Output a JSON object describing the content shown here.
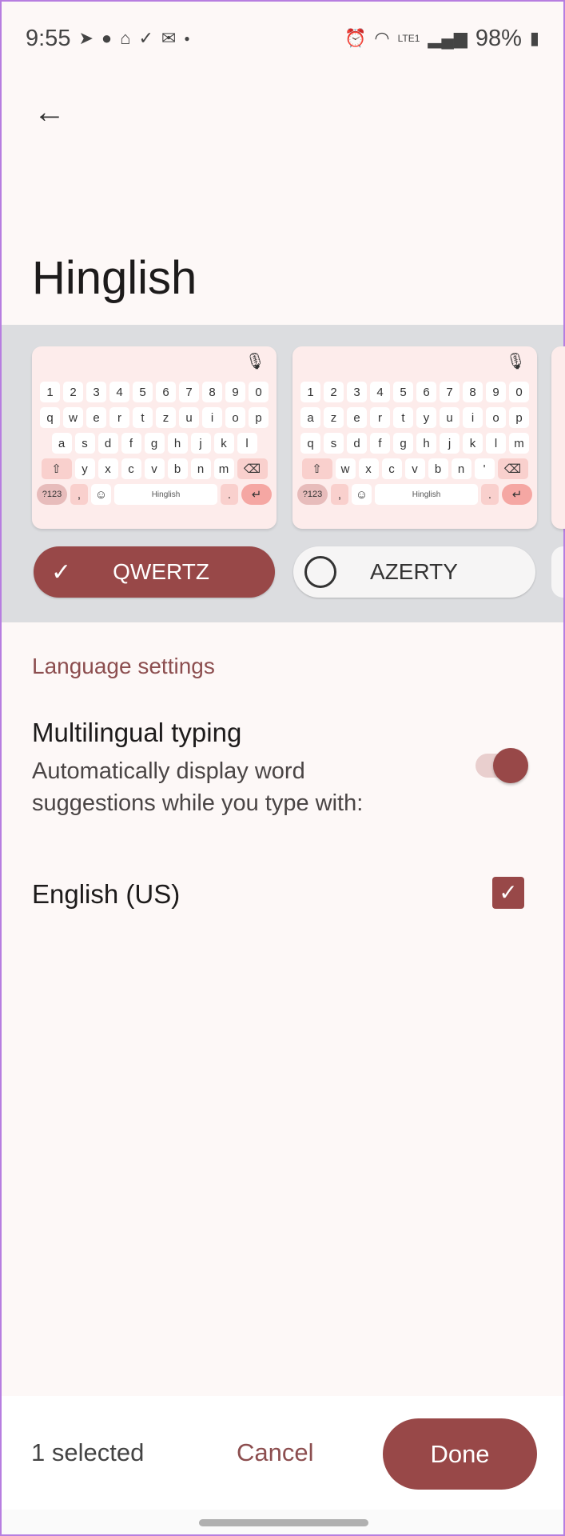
{
  "status": {
    "time": "9:55",
    "battery": "98%",
    "network": "LTE1",
    "left_icons": [
      "telegram-icon",
      "jio-icon",
      "mosque-icon",
      "task-icon",
      "mail-icon",
      "dot-icon"
    ],
    "right_icons": [
      "alarm-icon",
      "wifi-icon",
      "volte-icon",
      "signal-icon",
      "battery-icon"
    ]
  },
  "title": "Hinglish",
  "keyboards": [
    {
      "name": "QWERTZ",
      "selected": true,
      "rows": [
        [
          "1",
          "2",
          "3",
          "4",
          "5",
          "6",
          "7",
          "8",
          "9",
          "0"
        ],
        [
          "q",
          "w",
          "e",
          "r",
          "t",
          "z",
          "u",
          "i",
          "o",
          "p"
        ],
        [
          "a",
          "s",
          "d",
          "f",
          "g",
          "h",
          "j",
          "k",
          "l"
        ],
        [
          "y",
          "x",
          "c",
          "v",
          "b",
          "n",
          "m"
        ]
      ],
      "space": "Hinglish",
      "sym": "?123"
    },
    {
      "name": "AZERTY",
      "selected": false,
      "rows": [
        [
          "1",
          "2",
          "3",
          "4",
          "5",
          "6",
          "7",
          "8",
          "9",
          "0"
        ],
        [
          "a",
          "z",
          "e",
          "r",
          "t",
          "y",
          "u",
          "i",
          "o",
          "p"
        ],
        [
          "q",
          "s",
          "d",
          "f",
          "g",
          "h",
          "j",
          "k",
          "l",
          "m"
        ],
        [
          "w",
          "x",
          "c",
          "v",
          "b",
          "n",
          "'"
        ]
      ],
      "space": "Hinglish",
      "sym": "?123"
    }
  ],
  "section": "Language settings",
  "multilingual": {
    "title": "Multilingual typing",
    "subtitle": "Automatically display word suggestions while you type with:",
    "enabled": true
  },
  "languages": [
    {
      "label": "English (US)",
      "checked": true
    }
  ],
  "footer": {
    "selected": "1 selected",
    "cancel": "Cancel",
    "done": "Done"
  },
  "colors": {
    "accent": "#984848",
    "band": "#dcdde0",
    "background": "#fdf8f7"
  }
}
